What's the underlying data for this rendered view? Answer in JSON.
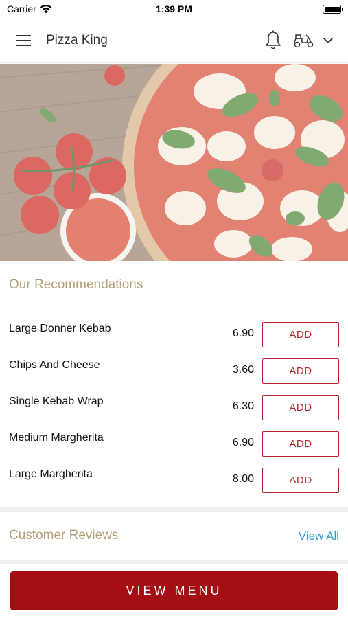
{
  "status_bar": {
    "carrier": "Carrier",
    "time": "1:39 PM",
    "battery_level": 1.0
  },
  "header": {
    "title": "Pizza King",
    "icons": [
      "menu-icon",
      "bell-icon",
      "scooter-icon",
      "chevron-down-icon"
    ]
  },
  "hero": {
    "image": "pizza-hero-image"
  },
  "recommendations": {
    "title": "Our Recommendations",
    "items": [
      {
        "name": "Large Donner Kebab",
        "price": "6.90",
        "button": "ADD"
      },
      {
        "name": "Chips And Cheese",
        "price": "3.60",
        "button": "ADD"
      },
      {
        "name": "Single Kebab Wrap",
        "price": "6.30",
        "button": "ADD"
      },
      {
        "name": "Medium Margherita",
        "price": "6.90",
        "button": "ADD"
      },
      {
        "name": "Large Margherita",
        "price": "8.00",
        "button": "ADD"
      }
    ]
  },
  "reviews": {
    "title": "Customer Reviews",
    "view_all": "View All"
  },
  "footer": {
    "view_menu": "VIEW MENU"
  },
  "colors": {
    "accent_red": "#a40f14",
    "add_red": "#b3272c",
    "section_gold": "#b3a079",
    "link_blue": "#2a9fd0"
  }
}
